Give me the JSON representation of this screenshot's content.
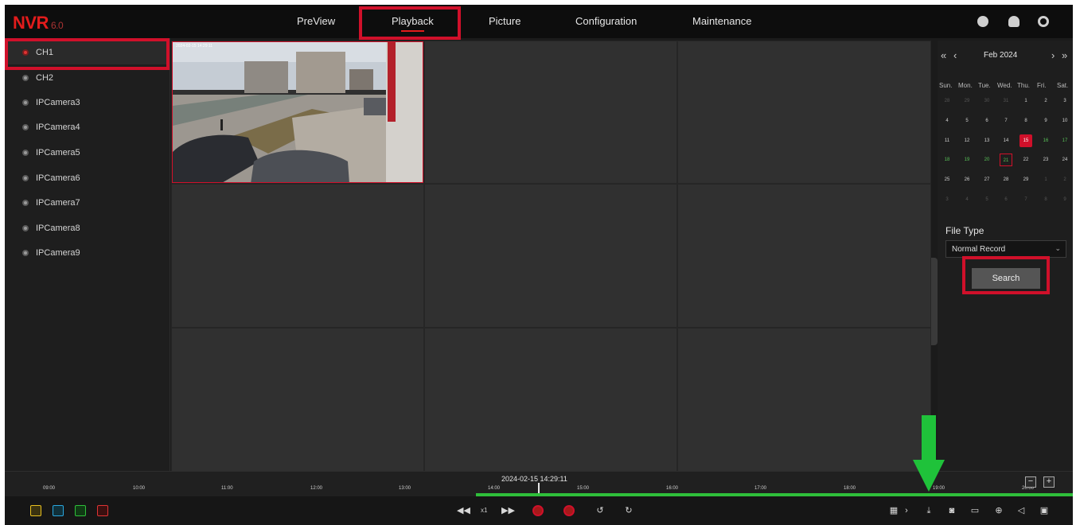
{
  "app": {
    "logo": "NVR",
    "version": "6.0"
  },
  "nav": [
    {
      "label": "PreView",
      "active": false
    },
    {
      "label": "Playback",
      "active": true
    },
    {
      "label": "Picture",
      "active": false
    },
    {
      "label": "Configuration",
      "active": false
    },
    {
      "label": "Maintenance",
      "active": false
    }
  ],
  "top_icons": [
    "user-icon",
    "cloud-icon",
    "settings-icon"
  ],
  "channels": [
    {
      "label": "CH1",
      "selected": true
    },
    {
      "label": "CH2",
      "selected": false
    },
    {
      "label": "IPCamera3",
      "selected": false
    },
    {
      "label": "IPCamera4",
      "selected": false
    },
    {
      "label": "IPCamera5",
      "selected": false
    },
    {
      "label": "IPCamera6",
      "selected": false
    },
    {
      "label": "IPCamera7",
      "selected": false
    },
    {
      "label": "IPCamera8",
      "selected": false
    },
    {
      "label": "IPCamera9",
      "selected": false
    }
  ],
  "camera1": {
    "osd_time": "2024-02-15 14:29:11"
  },
  "calendar": {
    "prev_year": "«",
    "prev_month": "‹",
    "month_label": "Feb 2024",
    "next_month": "›",
    "next_year": "»",
    "weekdays": [
      "Sun.",
      "Mon.",
      "Tue.",
      "Wed.",
      "Thu.",
      "Fri.",
      "Sat."
    ],
    "days": [
      [
        "28",
        "29",
        "30",
        "31",
        "1",
        "2",
        "3"
      ],
      [
        "4",
        "5",
        "6",
        "7",
        "8",
        "9",
        "10"
      ],
      [
        "11",
        "12",
        "13",
        "14",
        "15",
        "16",
        "17"
      ],
      [
        "18",
        "19",
        "20",
        "21",
        "22",
        "23",
        "24"
      ],
      [
        "25",
        "26",
        "27",
        "28",
        "29",
        "1",
        "2"
      ],
      [
        "3",
        "4",
        "5",
        "6",
        "7",
        "8",
        "9"
      ]
    ],
    "today": "15",
    "highlighted": "21",
    "record_days": [
      "15",
      "16",
      "17",
      "18",
      "19",
      "20",
      "21"
    ]
  },
  "file_type": {
    "label": "File Type",
    "value": "Normal Record"
  },
  "search": {
    "label": "Search"
  },
  "timeline": {
    "current_time": "2024-02-15 14:29:11",
    "ticks": [
      "09:00",
      "10:00",
      "11:00",
      "12:00",
      "13:00",
      "14:00",
      "15:00",
      "16:00",
      "17:00",
      "18:00",
      "19:00",
      "20:00"
    ],
    "zoom_out": "−",
    "zoom_in": "+"
  },
  "playback": {
    "speed": "x1"
  },
  "colors": {
    "accent": "#d0102a",
    "record": "#2fbf3a",
    "highlight": "#d0102a",
    "arrow": "#1fc23a"
  }
}
